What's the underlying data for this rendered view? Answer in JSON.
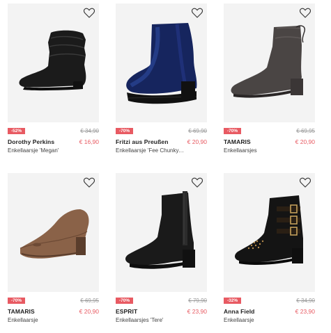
{
  "colors": {
    "sale": "#e85a62",
    "image_bg": "#f3f3f3",
    "old_price": "#9a9a9a"
  },
  "products": [
    {
      "brand": "Dorothy Perkins",
      "name": "Enkellaarsje 'Megan'",
      "discount": "-52%",
      "old_price": "€ 34,90",
      "new_price": "€ 16,90",
      "icon": "ankle-boot-black-slouch-icon"
    },
    {
      "brand": "Fritzi aus Preußen",
      "name": "Enkellaarsje 'Fee Chunky...'",
      "discount": "-70%",
      "old_price": "€ 69,90",
      "new_price": "€ 20,90",
      "icon": "ankle-boot-blue-velvet-icon"
    },
    {
      "brand": "TAMARIS",
      "name": "Enkellaarsjes",
      "discount": "-70%",
      "old_price": "€ 69,95",
      "new_price": "€ 20,90",
      "icon": "ankle-boot-grey-suede-icon"
    },
    {
      "brand": "TAMARIS",
      "name": "Enkellaarsje",
      "discount": "-70%",
      "old_price": "€ 69,95",
      "new_price": "€ 20,90",
      "icon": "pump-brown-icon"
    },
    {
      "brand": "ESPRIT",
      "name": "Enkellaarsjes 'Tere'",
      "discount": "-70%",
      "old_price": "€ 79,90",
      "new_price": "€ 23,90",
      "icon": "ankle-boot-black-elastic-icon"
    },
    {
      "brand": "Anna Field",
      "name": "Enkellaarsje",
      "discount": "-32%",
      "old_price": "€ 34,90",
      "new_price": "€ 23,90",
      "icon": "ankle-boot-studded-buckles-icon"
    }
  ]
}
